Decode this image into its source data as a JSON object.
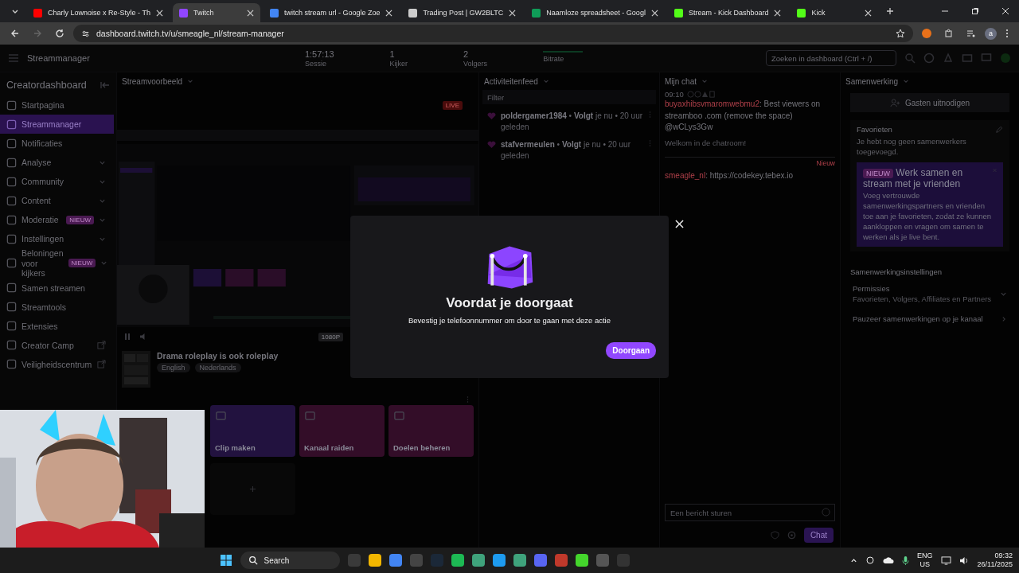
{
  "browser": {
    "tabs": [
      {
        "title": "Charly Lownoise x Re-Style - Th",
        "selected": false
      },
      {
        "title": "Twitch",
        "selected": true
      },
      {
        "title": "twitch stream url - Google Zoe",
        "selected": false
      },
      {
        "title": "Trading Post | GW2BLTC",
        "selected": false
      },
      {
        "title": "Naamloze spreadsheet - Googl",
        "selected": false
      },
      {
        "title": "Stream - Kick Dashboard",
        "selected": false
      },
      {
        "title": "Kick",
        "selected": false
      }
    ],
    "url": "dashboard.twitch.tv/u/smeagle_nl/stream-manager",
    "profile": "a"
  },
  "topbar": {
    "title": "Streammanager",
    "stats": [
      {
        "value": "1:57:13",
        "label": "Sessie"
      },
      {
        "value": "1",
        "label": "Kijker"
      },
      {
        "value": "2",
        "label": "Volgers"
      }
    ],
    "bitrate": "Bitrate",
    "search": {
      "placeholder": "Zoeken in dashboard (Ctrl + /)"
    }
  },
  "sidebar": {
    "title": "Creatordashboard",
    "items": [
      {
        "label": "Startpagina",
        "selected": false,
        "expandable": false,
        "external": false
      },
      {
        "label": "Streammanager",
        "selected": true,
        "expandable": false,
        "external": false
      },
      {
        "label": "Notificaties",
        "selected": false,
        "expandable": false,
        "external": false
      },
      {
        "label": "Analyse",
        "selected": false,
        "expandable": true,
        "external": false
      },
      {
        "label": "Community",
        "selected": false,
        "expandable": true,
        "external": false
      },
      {
        "label": "Content",
        "selected": false,
        "expandable": true,
        "external": false
      },
      {
        "label": "Moderatie",
        "selected": false,
        "expandable": true,
        "external": false,
        "badge": "NIEUW"
      },
      {
        "label": "Instellingen",
        "selected": false,
        "expandable": true,
        "external": false
      },
      {
        "label": "Beloningen voor kijkers",
        "selected": false,
        "expandable": true,
        "external": false,
        "badge": "NIEUW"
      },
      {
        "label": "Samen streamen",
        "selected": false,
        "expandable": false,
        "external": false
      },
      {
        "label": "Streamtools",
        "selected": false,
        "expandable": false,
        "external": false
      },
      {
        "label": "Extensies",
        "selected": false,
        "expandable": false,
        "external": false
      },
      {
        "label": "Creator Camp",
        "selected": false,
        "expandable": false,
        "external": true
      },
      {
        "label": "Veiligheidscentrum",
        "selected": false,
        "expandable": false,
        "external": true
      }
    ]
  },
  "preview": {
    "title": "Streamvoorbeeld",
    "live": "LIVE",
    "quality": "1080P",
    "stream_title": "Drama roleplay is ook roleplay",
    "tags": [
      "English",
      "Nederlands"
    ]
  },
  "quick_actions": [
    {
      "label": "Clip maken",
      "color": "#22123f"
    },
    {
      "label": "Kanaal raiden",
      "color": "#330d28"
    },
    {
      "label": "Doelen beheren",
      "color": "#330d28"
    }
  ],
  "activity": {
    "title": "Activiteitenfeed",
    "filter": {
      "placeholder": "Filter"
    },
    "events": [
      {
        "text": "**poldergamer1984** • **Volgt** je nu • 20 uur geleden"
      },
      {
        "text": "**stafvermeulen** • **Volgt** je nu • 20 uur geleden"
      }
    ]
  },
  "chat": {
    "title": "Mijn chat",
    "messages": [
      {
        "kind": "user",
        "time": "09:10",
        "user": "buyaxhibsvmaromwebmu2",
        "text": ": Best viewers on streamboo .com (remove the space) @wCLys3Gw"
      },
      {
        "kind": "system",
        "text": "Welkom in de chatroom!"
      },
      {
        "kind": "divider",
        "text": "Nieuw"
      },
      {
        "kind": "user",
        "user": "smeagle_nl",
        "text": ": https://codekey.tebex.io"
      }
    ],
    "input": {
      "placeholder": "Een bericht sturen"
    },
    "send": "Chat"
  },
  "collab": {
    "title": "Samenwerking",
    "invite": "Gasten uitnodigen",
    "favorites_title": "Favorieten",
    "favorites_empty": "Je hebt nog geen samenwerkers toegevoegd.",
    "promo": {
      "badge": "NIEUW",
      "title": "Werk samen en stream met je vrienden",
      "body": "Voeg vertrouwde samenwerkingspartners en vrienden toe aan je favorieten, zodat ze kunnen aankloppen en vragen om samen te werken als je live bent."
    },
    "settings_title": "Samenwerkingsinstellingen",
    "permissions_label": "Permissies",
    "permissions_value": "Favorieten, Volgers, Affiliates en Partners",
    "pause": "Pauzeer samenwerkingen op je kanaal"
  },
  "modal": {
    "title": "Voordat je doorgaat",
    "text": "Bevestig je telefoonnummer om door te gaan met deze actie",
    "button": "Doorgaan"
  },
  "taskbar": {
    "search": "Search",
    "lang": "ENG",
    "region": "US",
    "time": "09:32",
    "date": "26/11/2025"
  }
}
